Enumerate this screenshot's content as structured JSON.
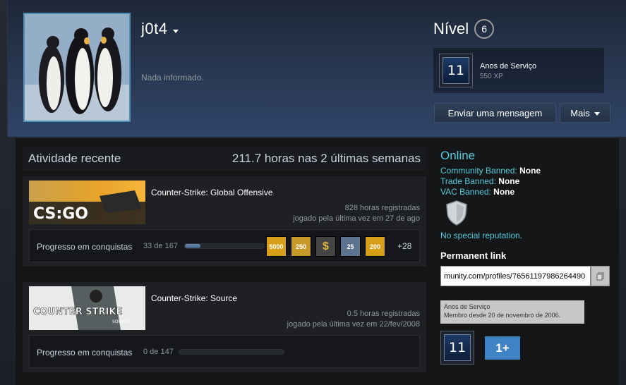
{
  "profile": {
    "persona_name": "j0t4",
    "summary": "Nada informado.",
    "level_label": "Nível",
    "level_value": "6",
    "featured_badge": {
      "number": "11",
      "title": "Anos de Serviço",
      "xp": "550 XP"
    },
    "buttons": {
      "send_message": "Enviar uma mensagem",
      "more": "Mais"
    }
  },
  "activity": {
    "title": "Atividade recente",
    "hours_summary": "211.7 horas nas 2 últimas semanas",
    "games": [
      {
        "name": "Counter-Strike: Global Offensive",
        "capsule_text": "CS:GO",
        "hours": "828 horas registradas",
        "last_played": "jogado pela última vez em 27 de ago",
        "achievements_label": "Progresso em conquistas",
        "achievements_count": "33 de 167",
        "achievements_progress": 0.2,
        "achievement_icons": [
          "5000",
          "250",
          "$",
          "25",
          "200"
        ],
        "more_achievements": "+28"
      },
      {
        "name": "Counter-Strike: Source",
        "capsule_text": "COUNTER STRIKE",
        "capsule_subtext": "SOURCE",
        "hours": "0.5 horas registradas",
        "last_played": "jogado pela última vez em 22/fev/2008",
        "achievements_label": "Progresso em conquistas",
        "achievements_count": "0 de 147",
        "achievements_progress": 0.0
      }
    ]
  },
  "sidebar": {
    "status": "Online",
    "community_banned_label": "Community Banned:",
    "community_banned_value": "None",
    "trade_banned_label": "Trade Banned:",
    "trade_banned_value": "None",
    "vac_banned_label": "VAC Banned:",
    "vac_banned_value": "None",
    "reputation": "No special reputation.",
    "permanent_link_title": "Permanent link",
    "permanent_link_value": "munity.com/profiles/76561197986264490",
    "tooltip_line1": "Anos de Serviço",
    "tooltip_line2": "Membro desde 20 de novembro de 2006.",
    "badges": [
      {
        "label": "11"
      },
      {
        "label": "1+"
      }
    ]
  },
  "colors": {
    "accent_online": "#57cbde",
    "header_gradient": "#2a3a56"
  }
}
